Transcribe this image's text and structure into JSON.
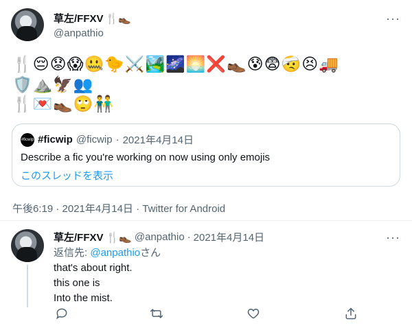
{
  "tweet": {
    "author_name": "草左/FFXV",
    "author_name_emoji": "🍴👞",
    "handle": "@anpathio",
    "emoji_rows": [
      "🍴😔😟😱🤐🐤⚔️🏞️🌌🌅❌👞😰😨🤕😣🚚",
      "🛡️⛰️🦅👥",
      "🍴💌👞🙄👬"
    ],
    "more_label": "···"
  },
  "quote": {
    "avatar_text": "#ficwip",
    "name": "#ficwip",
    "handle": "@ficwip",
    "separator": "·",
    "date": "2021年4月14日",
    "text": "Describe a fic you're working on now using only emojis",
    "thread_link": "このスレッドを表示"
  },
  "meta": {
    "text": "午後6:19 · 2021年4月14日 · Twitter for Android"
  },
  "reply": {
    "author_name": "草左/FFXV",
    "author_name_emoji": "🍴👞",
    "handle": "@anpathio",
    "separator": "·",
    "date": "2021年4月14日",
    "replying_prefix": "返信先: ",
    "replying_handle": "@anpathio",
    "replying_suffix": "さん",
    "lines": [
      "that's about right.",
      "this one is",
      "Into the mist."
    ],
    "more_label": "···"
  },
  "colors": {
    "text": "#0f1419",
    "muted": "#536471",
    "link": "#1d9bf0",
    "border": "#cfd9de"
  },
  "icons": [
    "reply-icon",
    "retweet-icon",
    "like-icon",
    "share-icon"
  ]
}
